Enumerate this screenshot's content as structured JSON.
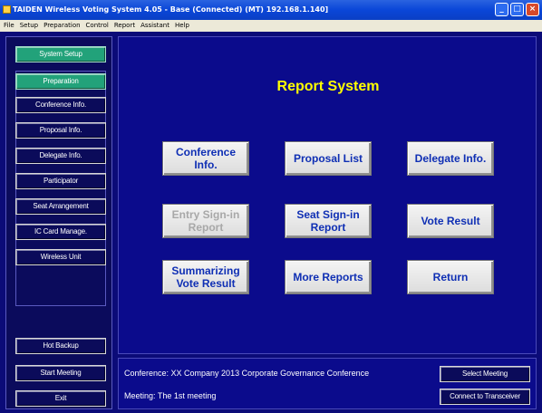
{
  "window": {
    "title": "TAIDEN Wireless Voting System 4.05 - Base (Connected) (MT) 192.168.1.140]"
  },
  "menubar": [
    "File",
    "Setup",
    "Preparation",
    "Control",
    "Report",
    "Assistant",
    "Help"
  ],
  "sidebar": {
    "system_setup": "System Setup",
    "items": [
      "Preparation",
      "Conference Info.",
      "Proposal Info.",
      "Delegate Info.",
      "Participator",
      "Seat Arrangement",
      "IC Card Manage.",
      "Wireless Unit"
    ],
    "hot_backup": "Hot Backup",
    "start_meeting": "Start Meeting",
    "exit": "Exit"
  },
  "main": {
    "title": "Report System",
    "buttons": [
      "Conference Info.",
      "Proposal List",
      "Delegate Info.",
      "Entry Sign-in Report",
      "Seat Sign-in Report",
      "Vote Result",
      "Summarizing Vote Result",
      "More Reports",
      "Return"
    ]
  },
  "infobar": {
    "conference": "Conference: XX Company 2013 Corporate Governance Conference",
    "meeting": "Meeting: The 1st meeting",
    "select_meeting": "Select Meeting",
    "connect": "Connect to Transceiver"
  },
  "colors": {
    "background": "#0b0b78",
    "panel": "#0b0b8c",
    "title_yellow": "#ffff00",
    "button_text_blue": "#0f2fb4",
    "button_disabled_text": "#a8a8a8",
    "sidebar_green": "#22a27a"
  }
}
